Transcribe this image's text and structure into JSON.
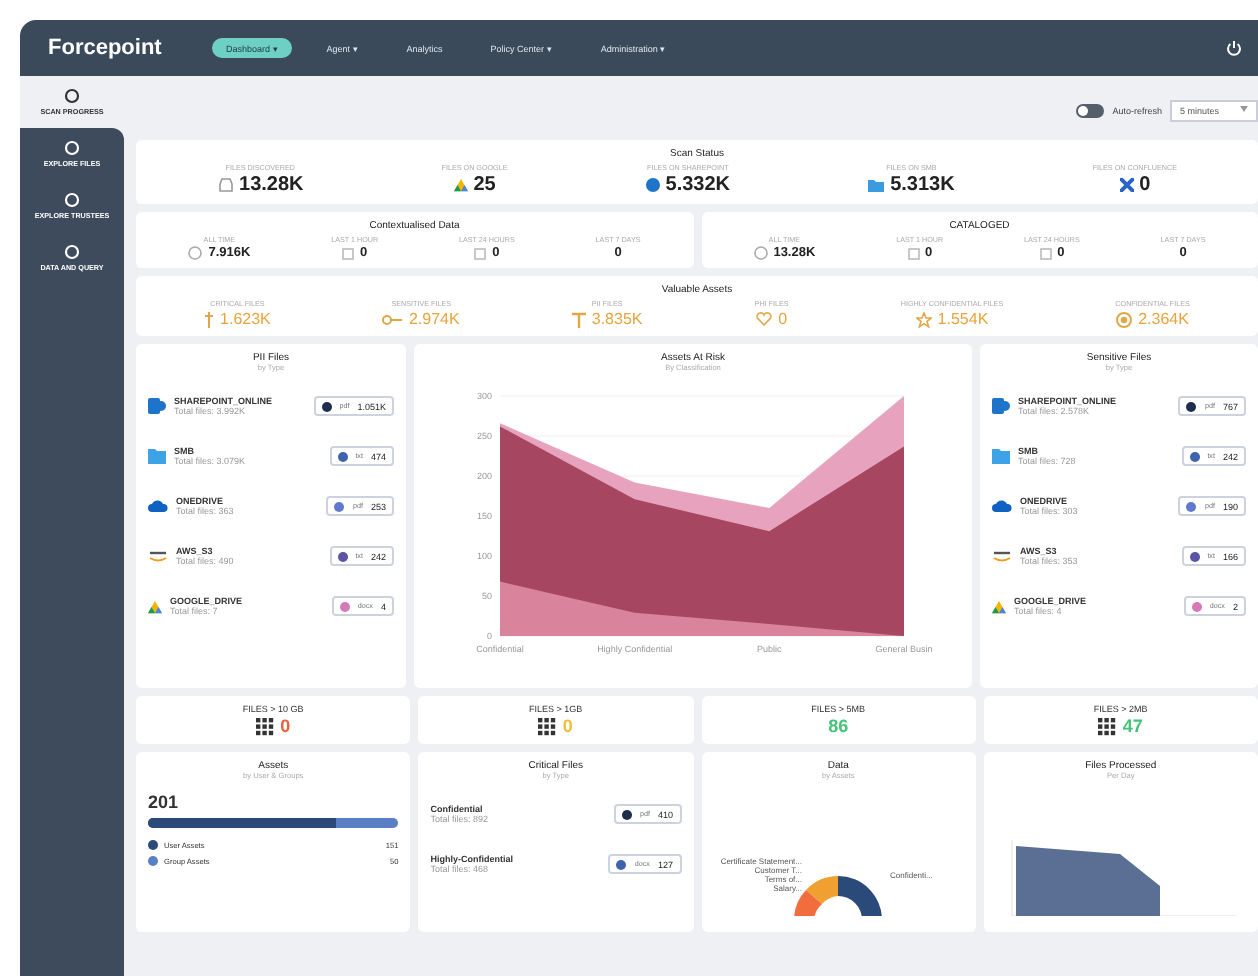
{
  "header": {
    "logo": "Forcepoint",
    "nav": [
      {
        "label": "Dashboard ▾",
        "selected": true
      },
      {
        "label": "Agent ▾",
        "selected": false
      },
      {
        "label": "Analytics",
        "selected": false
      },
      {
        "label": "Policy Center ▾",
        "selected": false
      },
      {
        "label": "Administration ▾",
        "selected": false
      }
    ]
  },
  "sidebar": {
    "items": [
      {
        "label": "SCAN PROGRESS",
        "selected": true
      },
      {
        "label": "EXPLORE FILES",
        "selected": false
      },
      {
        "label": "EXPLORE TRUSTEES",
        "selected": false
      },
      {
        "label": "DATA AND QUERY",
        "selected": false
      }
    ]
  },
  "toolbar": {
    "auto_refresh": {
      "label": "Auto-refresh",
      "on": false
    },
    "interval": {
      "value": "5 minutes"
    }
  },
  "scan_status": {
    "title": "Scan Status",
    "stats": [
      {
        "label": "FILES DISCOVERED",
        "value": "13.28K"
      },
      {
        "label": "FILES ON GOOGLE",
        "value": "25"
      },
      {
        "label": "FILES ON SHAREPOINT",
        "value": "5.332K"
      },
      {
        "label": "FILES ON SMB",
        "value": "5.313K"
      },
      {
        "label": "FILES ON CONFLUENCE",
        "value": "0"
      }
    ]
  },
  "contextualised_data": {
    "title": "Contextualised Data",
    "stats": [
      {
        "label": "ALL TIME",
        "value": "7.916K"
      },
      {
        "label": "LAST 1 HOUR",
        "value": "0"
      },
      {
        "label": "LAST 24 HOURS",
        "value": "0"
      },
      {
        "label": "LAST 7 DAYS",
        "value": "0"
      }
    ]
  },
  "cataloged": {
    "title": "CATALOGED",
    "stats": [
      {
        "label": "ALL TIME",
        "value": "13.28K"
      },
      {
        "label": "LAST 1 HOUR",
        "value": "0"
      },
      {
        "label": "LAST 24 HOURS",
        "value": "0"
      },
      {
        "label": "LAST 7 DAYS",
        "value": "0"
      }
    ]
  },
  "valuable_assets": {
    "title": "Valuable Assets",
    "stats": [
      {
        "label": "CRITICAL FILES",
        "value": "1.623K"
      },
      {
        "label": "SENSITIVE FILES",
        "value": "2.974K"
      },
      {
        "label": "PII FILES",
        "value": "3.835K"
      },
      {
        "label": "PHI FILES",
        "value": "0"
      },
      {
        "label": "HIGHLY CONFIDENTIAL FILES",
        "value": "1.554K"
      },
      {
        "label": "CONFIDENTIAL FILES",
        "value": "2.364K"
      }
    ]
  },
  "pii_files": {
    "title": "PII Files",
    "subtitle": "by Type",
    "rows": [
      {
        "name": "SHAREPOINT_ONLINE",
        "total": "Total files: 3.992K",
        "type": "pdf",
        "count": "1.051K",
        "color": "#1f2d4f"
      },
      {
        "name": "SMB",
        "total": "Total files: 3.079K",
        "type": "txt",
        "count": "474",
        "color": "#3f64ad"
      },
      {
        "name": "ONEDRIVE",
        "total": "Total files: 363",
        "type": "pdf",
        "count": "253",
        "color": "#6079cf"
      },
      {
        "name": "AWS_S3",
        "total": "Total files: 490",
        "type": "txt",
        "count": "242",
        "color": "#5a53a6"
      },
      {
        "name": "GOOGLE_DRIVE",
        "total": "Total files: 7",
        "type": "docx",
        "count": "4",
        "color": "#d47ab8"
      }
    ]
  },
  "assets_at_risk": {
    "title": "Assets At Risk",
    "subtitle": "By Classification",
    "chart_data": {
      "type": "area",
      "categories": [
        "Confidential",
        "Highly Confidential",
        "Public",
        "General Busin"
      ],
      "series": [
        {
          "color": "#e7a3bd",
          "values": [
            266,
            192,
            160,
            300
          ]
        },
        {
          "color": "#a64660",
          "values": [
            262,
            171,
            131,
            237
          ]
        },
        {
          "color": "#d9839c",
          "values": [
            68,
            29,
            15,
            0
          ]
        }
      ],
      "ylim": [
        0,
        300
      ],
      "yticks": [
        0,
        50,
        100,
        150,
        200,
        250,
        300
      ]
    }
  },
  "sensitive_files": {
    "title": "Sensitive Files",
    "subtitle": "by Type",
    "rows": [
      {
        "name": "SHAREPOINT_ONLINE",
        "total": "Total files: 2.578K",
        "type": "pdf",
        "count": "767",
        "color": "#1f2d4f"
      },
      {
        "name": "SMB",
        "total": "Total files: 728",
        "type": "txt",
        "count": "242",
        "color": "#3f64ad"
      },
      {
        "name": "ONEDRIVE",
        "total": "Total files: 303",
        "type": "pdf",
        "count": "190",
        "color": "#6079cf"
      },
      {
        "name": "AWS_S3",
        "total": "Total files: 353",
        "type": "txt",
        "count": "166",
        "color": "#5a53a6"
      },
      {
        "name": "GOOGLE_DRIVE",
        "total": "Total files: 4",
        "type": "docx",
        "count": "2",
        "color": "#d47ab8"
      }
    ]
  },
  "file_sizes": [
    {
      "label": "FILES > 10 GB",
      "value": "0",
      "color": "#e8623a"
    },
    {
      "label": "FILES > 1GB",
      "value": "0",
      "color": "#eebf3a"
    },
    {
      "label": "FILES > 5MB",
      "value": "86",
      "color": "#45c479"
    },
    {
      "label": "FILES > 2MB",
      "value": "47",
      "color": "#45c479"
    }
  ],
  "assets": {
    "title": "Assets",
    "subtitle": "by User & Groups",
    "total": "201",
    "level": 0.75,
    "legend": [
      {
        "label": "User Assets",
        "value": "151",
        "color": "#2a4a7a"
      },
      {
        "label": "Group Assets",
        "value": "50",
        "color": "#5b7fc4"
      }
    ]
  },
  "critical_files": {
    "title": "Critical Files",
    "subtitle": "by Type",
    "rows": [
      {
        "name": "Confidential",
        "total": "Total files: 892",
        "type": "pdf",
        "count": "410",
        "color": "#1f2d4f"
      },
      {
        "name": "Highly-Confidential",
        "total": "Total files: 468",
        "type": "docx",
        "count": "127",
        "color": "#3f64ad"
      }
    ]
  },
  "data": {
    "title": "Data",
    "subtitle": "by Assets",
    "slice_labels": [
      "Certificate Statement...",
      "Customer T...",
      "Terms of...",
      "Salary...",
      "Confidenti..."
    ]
  },
  "files_processed": {
    "title": "Files Processed",
    "subtitle": "Per Day"
  }
}
